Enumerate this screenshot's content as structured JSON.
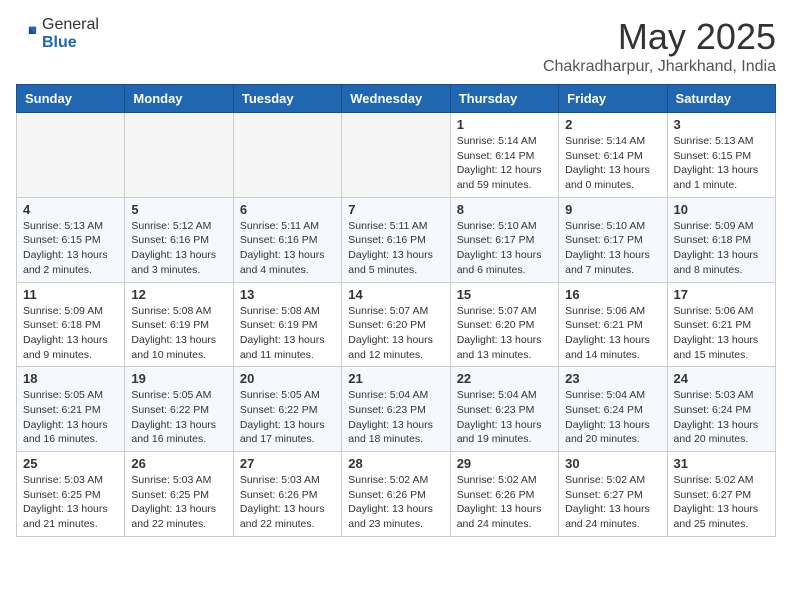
{
  "header": {
    "logo_general": "General",
    "logo_blue": "Blue",
    "title": "May 2025",
    "location": "Chakradharpur, Jharkhand, India"
  },
  "weekdays": [
    "Sunday",
    "Monday",
    "Tuesday",
    "Wednesday",
    "Thursday",
    "Friday",
    "Saturday"
  ],
  "weeks": [
    [
      {
        "day": "",
        "info": ""
      },
      {
        "day": "",
        "info": ""
      },
      {
        "day": "",
        "info": ""
      },
      {
        "day": "",
        "info": ""
      },
      {
        "day": "1",
        "info": "Sunrise: 5:14 AM\nSunset: 6:14 PM\nDaylight: 12 hours\nand 59 minutes."
      },
      {
        "day": "2",
        "info": "Sunrise: 5:14 AM\nSunset: 6:14 PM\nDaylight: 13 hours\nand 0 minutes."
      },
      {
        "day": "3",
        "info": "Sunrise: 5:13 AM\nSunset: 6:15 PM\nDaylight: 13 hours\nand 1 minute."
      }
    ],
    [
      {
        "day": "4",
        "info": "Sunrise: 5:13 AM\nSunset: 6:15 PM\nDaylight: 13 hours\nand 2 minutes."
      },
      {
        "day": "5",
        "info": "Sunrise: 5:12 AM\nSunset: 6:16 PM\nDaylight: 13 hours\nand 3 minutes."
      },
      {
        "day": "6",
        "info": "Sunrise: 5:11 AM\nSunset: 6:16 PM\nDaylight: 13 hours\nand 4 minutes."
      },
      {
        "day": "7",
        "info": "Sunrise: 5:11 AM\nSunset: 6:16 PM\nDaylight: 13 hours\nand 5 minutes."
      },
      {
        "day": "8",
        "info": "Sunrise: 5:10 AM\nSunset: 6:17 PM\nDaylight: 13 hours\nand 6 minutes."
      },
      {
        "day": "9",
        "info": "Sunrise: 5:10 AM\nSunset: 6:17 PM\nDaylight: 13 hours\nand 7 minutes."
      },
      {
        "day": "10",
        "info": "Sunrise: 5:09 AM\nSunset: 6:18 PM\nDaylight: 13 hours\nand 8 minutes."
      }
    ],
    [
      {
        "day": "11",
        "info": "Sunrise: 5:09 AM\nSunset: 6:18 PM\nDaylight: 13 hours\nand 9 minutes."
      },
      {
        "day": "12",
        "info": "Sunrise: 5:08 AM\nSunset: 6:19 PM\nDaylight: 13 hours\nand 10 minutes."
      },
      {
        "day": "13",
        "info": "Sunrise: 5:08 AM\nSunset: 6:19 PM\nDaylight: 13 hours\nand 11 minutes."
      },
      {
        "day": "14",
        "info": "Sunrise: 5:07 AM\nSunset: 6:20 PM\nDaylight: 13 hours\nand 12 minutes."
      },
      {
        "day": "15",
        "info": "Sunrise: 5:07 AM\nSunset: 6:20 PM\nDaylight: 13 hours\nand 13 minutes."
      },
      {
        "day": "16",
        "info": "Sunrise: 5:06 AM\nSunset: 6:21 PM\nDaylight: 13 hours\nand 14 minutes."
      },
      {
        "day": "17",
        "info": "Sunrise: 5:06 AM\nSunset: 6:21 PM\nDaylight: 13 hours\nand 15 minutes."
      }
    ],
    [
      {
        "day": "18",
        "info": "Sunrise: 5:05 AM\nSunset: 6:21 PM\nDaylight: 13 hours\nand 16 minutes."
      },
      {
        "day": "19",
        "info": "Sunrise: 5:05 AM\nSunset: 6:22 PM\nDaylight: 13 hours\nand 16 minutes."
      },
      {
        "day": "20",
        "info": "Sunrise: 5:05 AM\nSunset: 6:22 PM\nDaylight: 13 hours\nand 17 minutes."
      },
      {
        "day": "21",
        "info": "Sunrise: 5:04 AM\nSunset: 6:23 PM\nDaylight: 13 hours\nand 18 minutes."
      },
      {
        "day": "22",
        "info": "Sunrise: 5:04 AM\nSunset: 6:23 PM\nDaylight: 13 hours\nand 19 minutes."
      },
      {
        "day": "23",
        "info": "Sunrise: 5:04 AM\nSunset: 6:24 PM\nDaylight: 13 hours\nand 20 minutes."
      },
      {
        "day": "24",
        "info": "Sunrise: 5:03 AM\nSunset: 6:24 PM\nDaylight: 13 hours\nand 20 minutes."
      }
    ],
    [
      {
        "day": "25",
        "info": "Sunrise: 5:03 AM\nSunset: 6:25 PM\nDaylight: 13 hours\nand 21 minutes."
      },
      {
        "day": "26",
        "info": "Sunrise: 5:03 AM\nSunset: 6:25 PM\nDaylight: 13 hours\nand 22 minutes."
      },
      {
        "day": "27",
        "info": "Sunrise: 5:03 AM\nSunset: 6:26 PM\nDaylight: 13 hours\nand 22 minutes."
      },
      {
        "day": "28",
        "info": "Sunrise: 5:02 AM\nSunset: 6:26 PM\nDaylight: 13 hours\nand 23 minutes."
      },
      {
        "day": "29",
        "info": "Sunrise: 5:02 AM\nSunset: 6:26 PM\nDaylight: 13 hours\nand 24 minutes."
      },
      {
        "day": "30",
        "info": "Sunrise: 5:02 AM\nSunset: 6:27 PM\nDaylight: 13 hours\nand 24 minutes."
      },
      {
        "day": "31",
        "info": "Sunrise: 5:02 AM\nSunset: 6:27 PM\nDaylight: 13 hours\nand 25 minutes."
      }
    ]
  ]
}
